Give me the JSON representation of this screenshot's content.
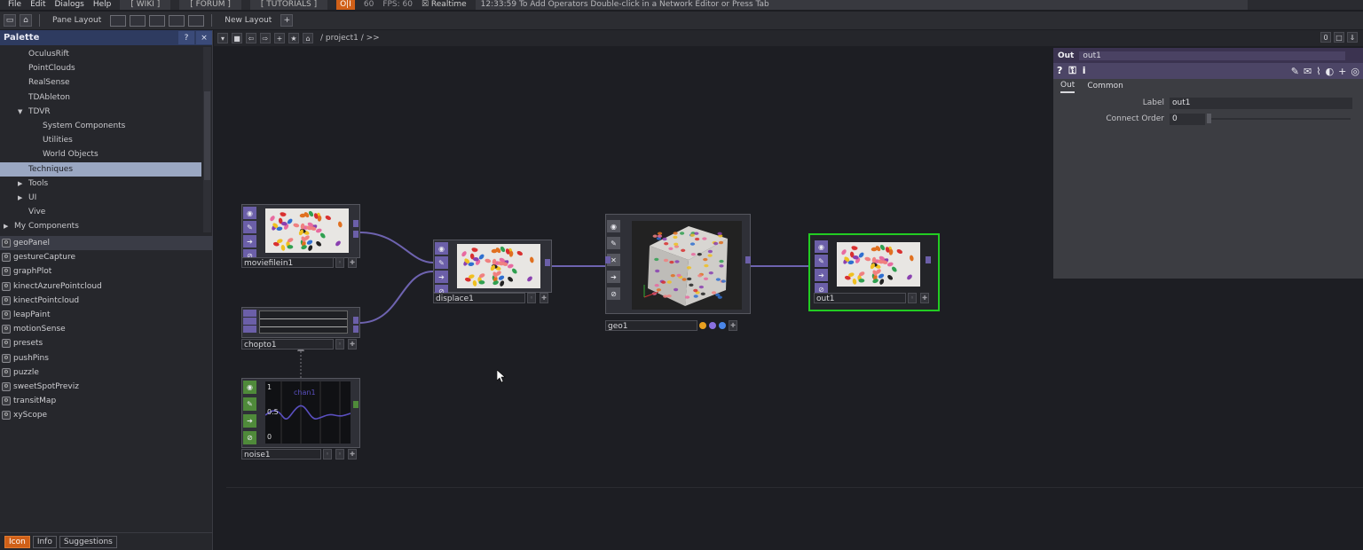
{
  "menubar": {
    "items": [
      "File",
      "Edit",
      "Dialogs",
      "Help"
    ],
    "wiki": "[ WIKI ]",
    "forum": "[ FORUM ]",
    "tutorials": "[ TUTORIALS ]",
    "oi": "O|I",
    "fps_target": "60",
    "fps": "FPS:  60",
    "realtime": "Realtime",
    "status": "12:33:59 To Add Operators Double-click in a Network Editor or Press Tab"
  },
  "toolbar2": {
    "pane_layout": "Pane Layout",
    "new_layout": "New Layout",
    "plus": "+"
  },
  "palette": {
    "title": "Palette",
    "help": "?",
    "close": "×",
    "tree": [
      {
        "label": "OculusRift",
        "indent": 2
      },
      {
        "label": "PointClouds",
        "indent": 2
      },
      {
        "label": "RealSense",
        "indent": 2
      },
      {
        "label": "TDAbleton",
        "indent": 2
      },
      {
        "label": "TDVR",
        "indent": 2,
        "expanded": true
      },
      {
        "label": "System Components",
        "indent": 3
      },
      {
        "label": "Utilities",
        "indent": 3
      },
      {
        "label": "World Objects",
        "indent": 3
      },
      {
        "label": "Techniques",
        "indent": 2,
        "selected": true
      },
      {
        "label": "Tools",
        "indent": 2,
        "collapsed": true
      },
      {
        "label": "UI",
        "indent": 2,
        "collapsed": true
      },
      {
        "label": "Vive",
        "indent": 2
      },
      {
        "label": "My Components",
        "indent": 1,
        "collapsed": true
      }
    ],
    "components": [
      "geoPanel",
      "gestureCapture",
      "graphPlot",
      "kinectAzurePointcloud",
      "kinectPointcloud",
      "leapPaint",
      "motionSense",
      "presets",
      "pushPins",
      "puzzle",
      "sweetSpotPreviz",
      "transitMap",
      "xyScope"
    ],
    "tabs": [
      "Icon",
      "Info",
      "Suggestions"
    ]
  },
  "network": {
    "breadcrumb": "/ project1 /  >>",
    "right_buttons": [
      "0",
      "□",
      "⇓"
    ],
    "nodes": {
      "moviefilein1": "moviefilein1",
      "displace1": "displace1",
      "chopto1": "chopto1",
      "noise1": "noise1",
      "geo1": "geo1",
      "out1": "out1"
    },
    "noise_chart": {
      "top": "1",
      "mid": "0.5",
      "bottom": "0",
      "channel": "chan1"
    }
  },
  "params": {
    "type": "Out",
    "name": "out1",
    "tabs": [
      "Out",
      "Common"
    ],
    "label_label": "Label",
    "label_value": "out1",
    "connect_label": "Connect Order",
    "connect_value": "0"
  },
  "colors": {
    "accent_orange": "#d06018",
    "palette_header": "#2e3b60",
    "top_purple": "#6b5fa8",
    "chop_green": "#4f8a3a",
    "display_flag": "#22cc22"
  }
}
